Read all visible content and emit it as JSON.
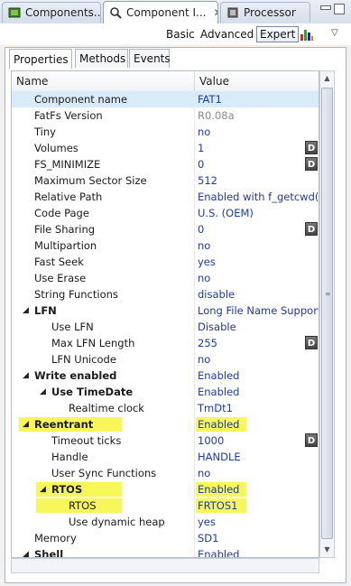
{
  "tabs": [
    {
      "label": "Components...",
      "active": false
    },
    {
      "label": "Component I...",
      "active": true
    },
    {
      "label": "Processor",
      "active": false
    }
  ],
  "toolbar": {
    "basic": "Basic",
    "advanced": "Advanced",
    "expert": "Expert"
  },
  "subtabs": [
    "Properties",
    "Methods",
    "Events"
  ],
  "columns": {
    "name": "Name",
    "value": "Value"
  },
  "rows": [
    {
      "name": "Component name",
      "value": "FAT1"
    },
    {
      "name": "FatFs Version",
      "value": "R0.08a"
    },
    {
      "name": "Tiny",
      "value": "no"
    },
    {
      "name": "Volumes",
      "value": "1",
      "d": "D"
    },
    {
      "name": "FS_MINIMIZE",
      "value": "0",
      "d": "D"
    },
    {
      "name": "Maximum Sector Size",
      "value": "512"
    },
    {
      "name": "Relative Path",
      "value": "Enabled with f_getcwd()"
    },
    {
      "name": "Code Page",
      "value": "U.S. (OEM)"
    },
    {
      "name": "File Sharing",
      "value": "0",
      "d": "D"
    },
    {
      "name": "Multipartion",
      "value": "no"
    },
    {
      "name": "Fast Seek",
      "value": "yes"
    },
    {
      "name": "Use Erase",
      "value": "no"
    },
    {
      "name": "String Functions",
      "value": "disable"
    },
    {
      "name": "LFN",
      "value": "Long File Name Support"
    },
    {
      "name": "Use LFN",
      "value": "Disable"
    },
    {
      "name": "Max LFN Length",
      "value": "255",
      "d": "D"
    },
    {
      "name": "LFN Unicode",
      "value": "no"
    },
    {
      "name": "Write enabled",
      "value": "Enabled"
    },
    {
      "name": "Use TimeDate",
      "value": "Enabled"
    },
    {
      "name": "Realtime clock",
      "value": "TmDt1"
    },
    {
      "name": "Reentrant",
      "value": "Enabled"
    },
    {
      "name": "Timeout ticks",
      "value": "1000",
      "d": "D"
    },
    {
      "name": "Handle",
      "value": "HANDLE"
    },
    {
      "name": "User Sync Functions",
      "value": "no"
    },
    {
      "name": "RTOS",
      "value": "Enabled"
    },
    {
      "name": "RTOS",
      "value": "FRTOS1"
    },
    {
      "name": "Use dynamic heap",
      "value": "yes"
    },
    {
      "name": "Memory",
      "value": "SD1"
    },
    {
      "name": "Shell",
      "value": "Enabled"
    }
  ],
  "colors": {
    "highlight": "#f8f75a",
    "value_text": "#1d3aa8",
    "selection": "#d9ebfb"
  }
}
